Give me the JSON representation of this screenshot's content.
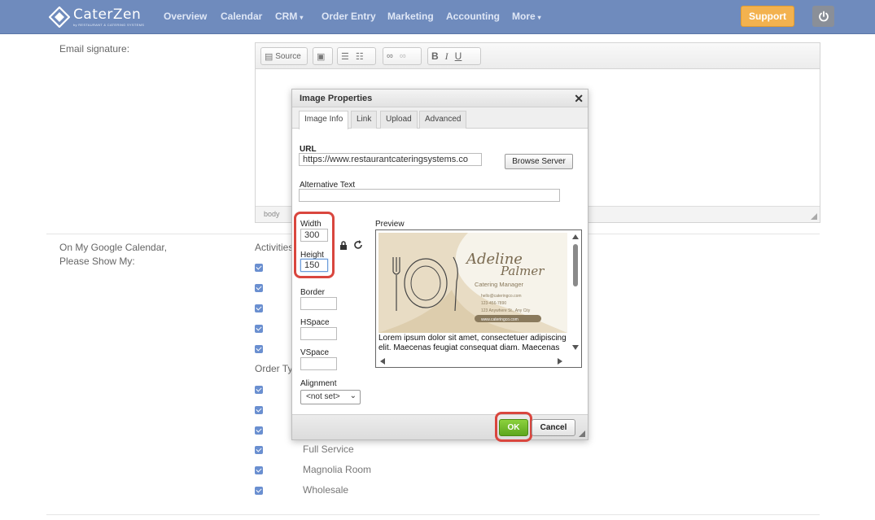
{
  "brand": {
    "name": "CaterZen",
    "tagline": "by RESTAURANT & CATERING SYSTEMS"
  },
  "nav": {
    "items": [
      {
        "label": "Overview",
        "caret": ""
      },
      {
        "label": "Calendar",
        "caret": ""
      },
      {
        "label": "CRM",
        "caret": "▾"
      },
      {
        "label": "Order Entry",
        "caret": ""
      },
      {
        "label": "Marketing",
        "caret": ""
      },
      {
        "label": "Accounting",
        "caret": ""
      },
      {
        "label": "More",
        "caret": "▾"
      }
    ],
    "support_label": "Support",
    "power_icon": "power-icon"
  },
  "page": {
    "email_signature_label": "Email signature:",
    "google_calendar_label_1": "On My Google Calendar,",
    "google_calendar_label_2": "Please Show My:",
    "activities_label": "Activities",
    "order_types_label": "Order Ty",
    "checkbox_rows": [
      {
        "label": "Full Service"
      },
      {
        "label": "Magnolia Room"
      },
      {
        "label": "Wholesale"
      }
    ]
  },
  "editor": {
    "toolbar": {
      "source_label": "Source",
      "bold": "B",
      "italic": "I",
      "underline": "U"
    },
    "footer_path": "body"
  },
  "dialog": {
    "title": "Image Properties",
    "close_glyph": "✕",
    "tabs": [
      {
        "label": "Image Info",
        "active": true
      },
      {
        "label": "Link",
        "active": false
      },
      {
        "label": "Upload",
        "active": false
      },
      {
        "label": "Advanced",
        "active": false
      }
    ],
    "url_label": "URL",
    "url_value": "https://www.restaurantcateringsystems.co",
    "browse_label": "Browse Server",
    "alt_label": "Alternative Text",
    "alt_value": "",
    "width_label": "Width",
    "width_value": "300",
    "height_label": "Height",
    "height_value": "150",
    "border_label": "Border",
    "hspace_label": "HSpace",
    "vspace_label": "VSpace",
    "alignment_label": "Alignment",
    "alignment_value": "<not set>",
    "preview_label": "Preview",
    "preview_text": "Lorem ipsum dolor sit amet, consectetuer adipiscing elit. Maecenas feugiat consequat diam. Maecenas",
    "card": {
      "name_first": "Adeline",
      "name_last": "Palmer",
      "role": "Catering Manager",
      "email": "hello@cateringco.com",
      "phone": "123-456-7890",
      "address": "123 Anywhere St., Any City",
      "website": "www.cateringco.com"
    },
    "ok_label": "OK",
    "cancel_label": "Cancel"
  },
  "colors": {
    "nav_bg": "#6f8bbd",
    "support_bg": "#f3b24f",
    "ok_green": "#6cb52a",
    "highlight_red": "#d9463e",
    "checkbox_blue": "#6a8fd0"
  }
}
